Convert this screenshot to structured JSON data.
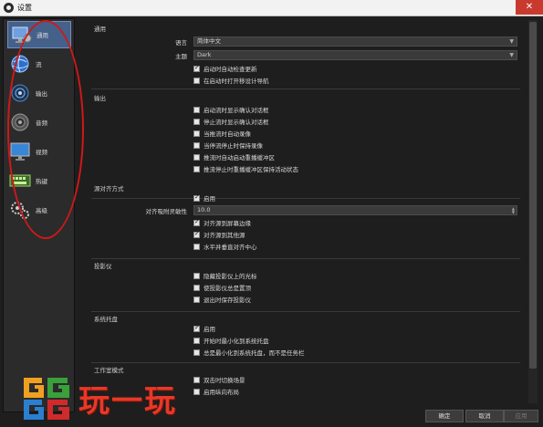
{
  "window": {
    "title": "设置",
    "close_glyph": "✕"
  },
  "sidebar": {
    "items": [
      {
        "label": "通用",
        "icon": "computer-gear-icon",
        "selected": true
      },
      {
        "label": "流",
        "icon": "globe-icon"
      },
      {
        "label": "输出",
        "icon": "broadcast-icon"
      },
      {
        "label": "音频",
        "icon": "speaker-icon"
      },
      {
        "label": "视频",
        "icon": "monitor-icon"
      },
      {
        "label": "热键",
        "icon": "keyboard-icon"
      },
      {
        "label": "高级",
        "icon": "gears-icon"
      }
    ]
  },
  "general": {
    "title": "通用",
    "language_label": "语言",
    "language_value": "简体中文",
    "theme_label": "主题",
    "theme_value": "Dark",
    "checkboxes": [
      {
        "label": "启动时自动检查更新",
        "checked": true
      },
      {
        "label": "在启动时打开移设计导航",
        "checked": false
      }
    ]
  },
  "output": {
    "title": "输出",
    "checkboxes": [
      {
        "label": "启动流时显示确认对话框",
        "checked": false
      },
      {
        "label": "停止流时显示确认对话框",
        "checked": false
      },
      {
        "label": "当推流时自动录像",
        "checked": false
      },
      {
        "label": "当停流停止时保持录像",
        "checked": false
      },
      {
        "label": "推流时自动启动重播缓冲区",
        "checked": false
      },
      {
        "label": "推流停止时重播缓冲区保持活动状态",
        "checked": false
      }
    ]
  },
  "snapping": {
    "title": "源对齐方式",
    "enabled_label": "启用",
    "enabled_checked": true,
    "sensitivity_label": "对齐吸附灵敏性",
    "sensitivity_value": "10.0",
    "checkboxes": [
      {
        "label": "对齐源到屏幕边缘",
        "checked": true
      },
      {
        "label": "对齐源到其他源",
        "checked": true
      },
      {
        "label": "水平并垂直对齐中心",
        "checked": false
      }
    ]
  },
  "projectors": {
    "title": "投影仪",
    "checkboxes": [
      {
        "label": "隐藏投影仪上的光标",
        "checked": false
      },
      {
        "label": "使投影仪总是置顶",
        "checked": false
      },
      {
        "label": "退出时保存投影仪",
        "checked": false
      }
    ]
  },
  "tray": {
    "title": "系统托盘",
    "checkboxes": [
      {
        "label": "启用",
        "checked": true
      },
      {
        "label": "开始时最小化到系统托盘",
        "checked": false
      },
      {
        "label": "总是最小化到系统托盘，而不是任务栏",
        "checked": false
      }
    ]
  },
  "studio": {
    "title": "工作室模式",
    "checkboxes": [
      {
        "label": "双击时切换场景",
        "checked": false
      },
      {
        "label": "启用纵向布局",
        "checked": false
      }
    ]
  },
  "footer": {
    "ok": "确定",
    "cancel": "取消",
    "apply": "应用"
  },
  "watermark": {
    "text": "玩一玩",
    "logo": "gg-logo"
  },
  "colors": {
    "selected_bg": "#45618a",
    "annotation_red": "#d01818",
    "watermark_red": "#e83828"
  }
}
